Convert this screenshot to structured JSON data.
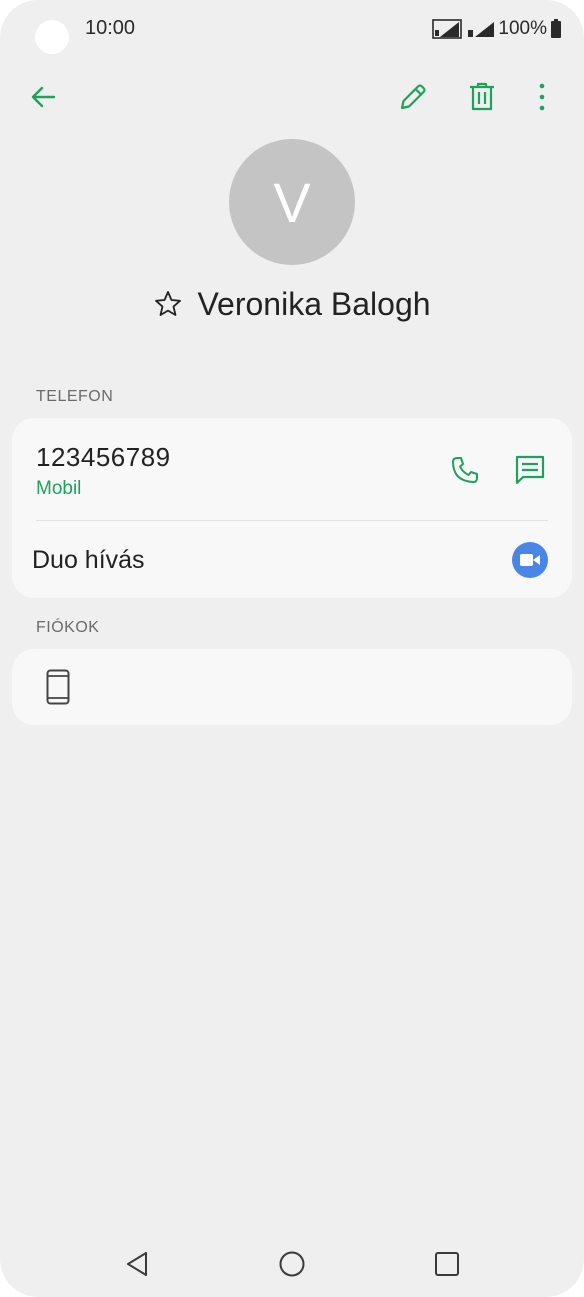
{
  "status_bar": {
    "time": "10:00",
    "battery": "100%"
  },
  "toolbar": {
    "back_icon": "arrow-left-icon",
    "edit_icon": "pencil-icon",
    "delete_icon": "trash-icon",
    "more_icon": "more-vert-icon"
  },
  "contact": {
    "initial": "V",
    "name": "Veronika Balogh",
    "favorite_icon": "star-outline-icon"
  },
  "phone_section": {
    "label": "TELEFON",
    "number": "123456789",
    "type": "Mobil",
    "call_icon": "phone-icon",
    "message_icon": "message-icon",
    "duo_label": "Duo hívás",
    "duo_icon": "duo-video-icon"
  },
  "accounts_section": {
    "label": "FIÓKOK",
    "device_icon": "phone-device-icon"
  },
  "nav_bar": {
    "back": "nav-back-icon",
    "home": "nav-home-icon",
    "recents": "nav-recents-icon"
  },
  "colors": {
    "accent": "#1ea15a",
    "background": "#efefef",
    "card": "#f8f8f8",
    "avatar": "#c4c4c4",
    "duo": "#4a86e8"
  }
}
